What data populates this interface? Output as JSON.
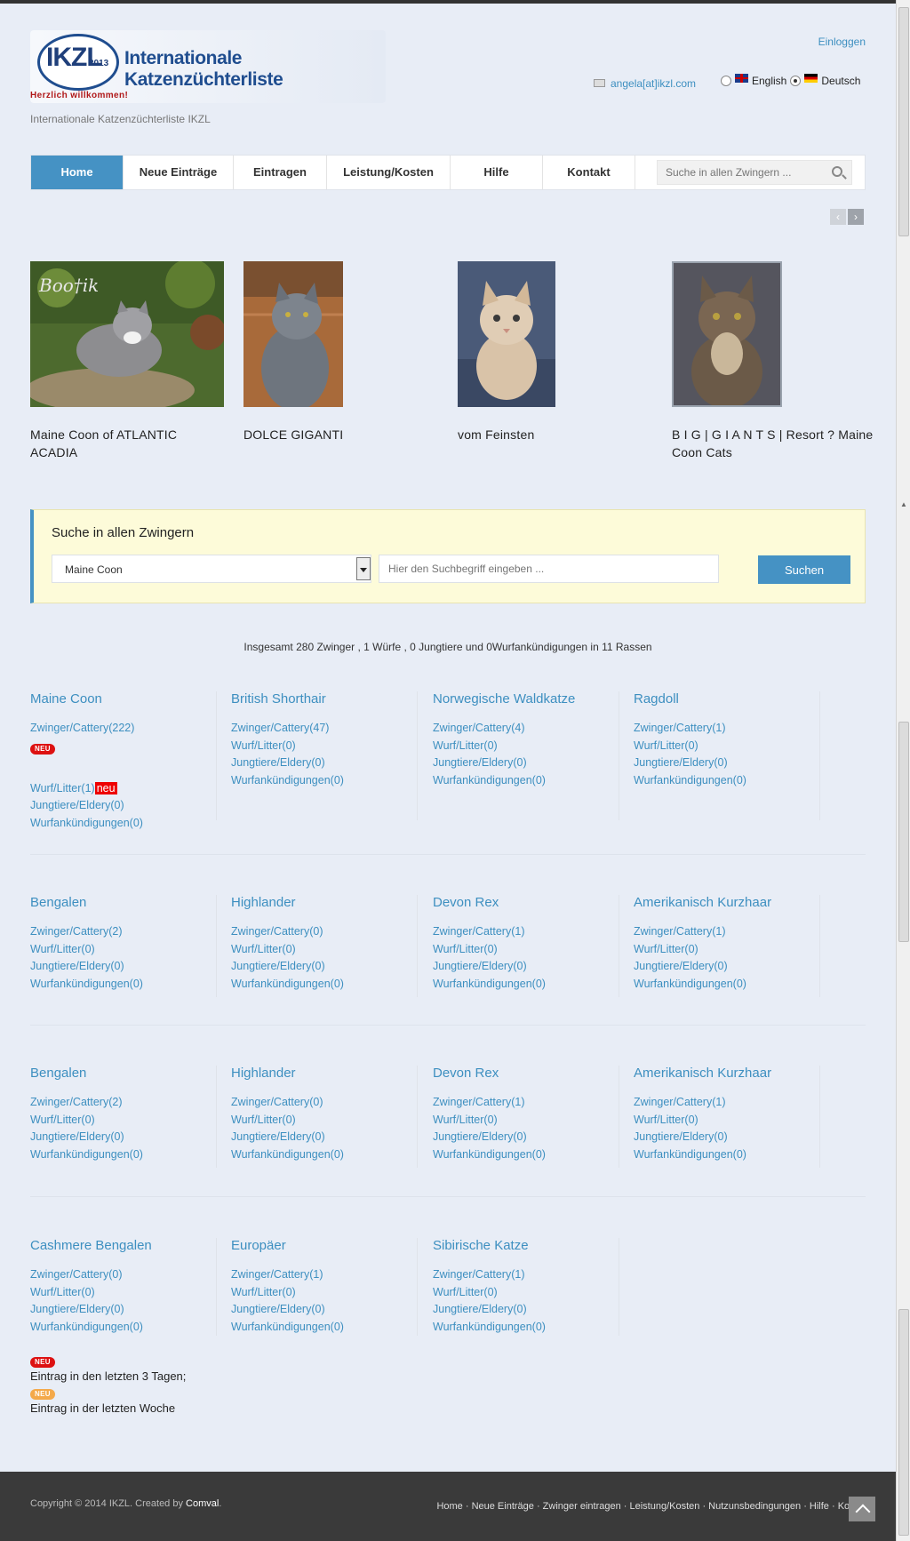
{
  "header": {
    "logo_abbr": "IKZL",
    "logo_year": "2013",
    "logo_title": "Internationale Katzenzüchterliste",
    "logo_welcome": "Herzlich willkommen!",
    "tagline": "Internationale Katzenzüchterliste IKZL",
    "login": "Einloggen",
    "email": "angela[at]ikzl.com",
    "lang_en": "English",
    "lang_de": "Deutsch"
  },
  "nav": {
    "items": [
      "Home",
      "Neue Einträge",
      "Eintragen",
      "Leistung/Kosten",
      "Hilfe",
      "Kontakt"
    ],
    "search_placeholder": "Suche in allen Zwingern ..."
  },
  "slider": {
    "prev": "‹",
    "next": "›",
    "items": [
      {
        "title": "Maine Coon of ATLANTIC ACADIA",
        "img_label": "Boo†ik"
      },
      {
        "title": "DOLCE GIGANTI"
      },
      {
        "title": "vom Feinsten"
      },
      {
        "title": "B I G | G I A N T S | Resort ? Maine Coon Cats"
      }
    ]
  },
  "search": {
    "heading": "Suche in allen Zwingern",
    "breed_selected": "Maine Coon",
    "term_placeholder": "Hier den Suchbegriff eingeben ...",
    "button": "Suchen"
  },
  "summary": "Insgesamt 280 Zwinger , 1 Würfe , 0 Jungtiere und 0Wurfankündigungen in 11 Rassen",
  "badges": {
    "neu": "NEU",
    "neu_inline": "neu"
  },
  "breeds": {
    "row1": [
      {
        "name": "Maine Coon",
        "cattery": "Zwinger/Cattery(222)",
        "litter": "Wurf/Litter(1)",
        "eldery": "Jungtiere/Eldery(0)",
        "ann": "Wurfankündigungen(0)"
      },
      {
        "name": "British Shorthair",
        "cattery": "Zwinger/Cattery(47)",
        "litter": "Wurf/Litter(0)",
        "eldery": "Jungtiere/Eldery(0)",
        "ann": "Wurfankündigungen(0)"
      },
      {
        "name": "Norwegische Waldkatze",
        "cattery": "Zwinger/Cattery(4)",
        "litter": "Wurf/Litter(0)",
        "eldery": "Jungtiere/Eldery(0)",
        "ann": "Wurfankündigungen(0)"
      },
      {
        "name": "Ragdoll",
        "cattery": "Zwinger/Cattery(1)",
        "litter": "Wurf/Litter(0)",
        "eldery": "Jungtiere/Eldery(0)",
        "ann": "Wurfankündigungen(0)"
      }
    ],
    "row2": [
      {
        "name": "Bengalen",
        "cattery": "Zwinger/Cattery(2)",
        "litter": "Wurf/Litter(0)",
        "eldery": "Jungtiere/Eldery(0)",
        "ann": "Wurfankündigungen(0)"
      },
      {
        "name": "Highlander",
        "cattery": "Zwinger/Cattery(0)",
        "litter": "Wurf/Litter(0)",
        "eldery": "Jungtiere/Eldery(0)",
        "ann": "Wurfankündigungen(0)"
      },
      {
        "name": "Devon Rex",
        "cattery": "Zwinger/Cattery(1)",
        "litter": "Wurf/Litter(0)",
        "eldery": "Jungtiere/Eldery(0)",
        "ann": "Wurfankündigungen(0)"
      },
      {
        "name": "Amerikanisch Kurzhaar",
        "cattery": "Zwinger/Cattery(1)",
        "litter": "Wurf/Litter(0)",
        "eldery": "Jungtiere/Eldery(0)",
        "ann": "Wurfankündigungen(0)"
      }
    ],
    "row3": [
      {
        "name": "Bengalen",
        "cattery": "Zwinger/Cattery(2)",
        "litter": "Wurf/Litter(0)",
        "eldery": "Jungtiere/Eldery(0)",
        "ann": "Wurfankündigungen(0)"
      },
      {
        "name": "Highlander",
        "cattery": "Zwinger/Cattery(0)",
        "litter": "Wurf/Litter(0)",
        "eldery": "Jungtiere/Eldery(0)",
        "ann": "Wurfankündigungen(0)"
      },
      {
        "name": "Devon Rex",
        "cattery": "Zwinger/Cattery(1)",
        "litter": "Wurf/Litter(0)",
        "eldery": "Jungtiere/Eldery(0)",
        "ann": "Wurfankündigungen(0)"
      },
      {
        "name": "Amerikanisch Kurzhaar",
        "cattery": "Zwinger/Cattery(1)",
        "litter": "Wurf/Litter(0)",
        "eldery": "Jungtiere/Eldery(0)",
        "ann": "Wurfankündigungen(0)"
      }
    ],
    "row4": [
      {
        "name": "Cashmere Bengalen",
        "cattery": "Zwinger/Cattery(0)",
        "litter": "Wurf/Litter(0)",
        "eldery": "Jungtiere/Eldery(0)",
        "ann": "Wurfankündigungen(0)"
      },
      {
        "name": "Europäer",
        "cattery": "Zwinger/Cattery(1)",
        "litter": "Wurf/Litter(0)",
        "eldery": "Jungtiere/Eldery(0)",
        "ann": "Wurfankündigungen(0)"
      },
      {
        "name": "Sibirische Katze",
        "cattery": "Zwinger/Cattery(1)",
        "litter": "Wurf/Litter(0)",
        "eldery": "Jungtiere/Eldery(0)",
        "ann": "Wurfankündigungen(0)"
      }
    ]
  },
  "legend": {
    "line1": "Eintrag in den letzten 3 Tagen;",
    "line2": "Eintrag in der letzten Woche"
  },
  "footer": {
    "copyright_prefix": "Copyright © 2014 IKZL. Created by ",
    "copyright_name": "Comval",
    "copyright_suffix": ".",
    "links": "Home · Neue Einträge · Zwinger eintragen · Leistung/Kosten · Nutzunsbedingungen · Hilfe · Kontakt"
  },
  "colors": {
    "accent": "#4592c4",
    "link": "#3d8fc0",
    "badge_new": "#d11111",
    "badge_week": "#f4a94a",
    "footer": "#3a3a3a"
  }
}
